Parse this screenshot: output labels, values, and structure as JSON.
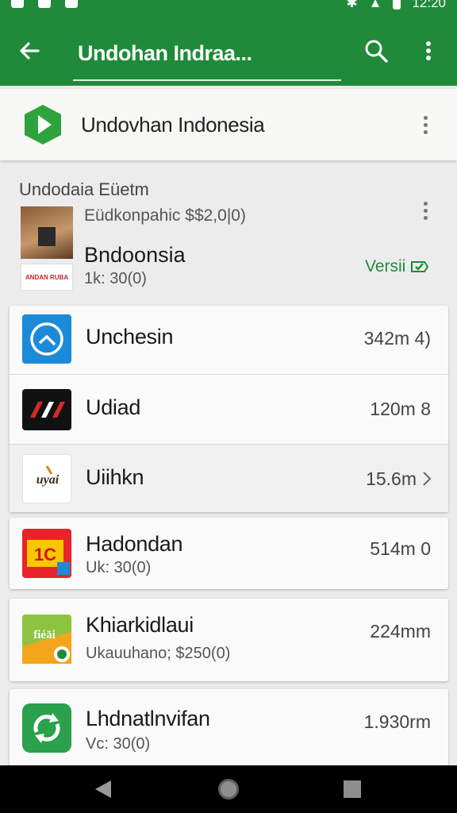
{
  "status_bar": {
    "time": "12:20"
  },
  "app_bar": {
    "search_text": "Undohan Indraa..."
  },
  "header": {
    "title": "Undovhan Indonesia"
  },
  "featured": {
    "section_label": "Undodaia Eüetm",
    "meta": "Eüdkonpahic $$2,0|0)",
    "name": "Bndoonsia",
    "sub": "1k: 30(0)",
    "version_label": "Versii",
    "thumb_text": "ANDAN RUBA"
  },
  "group_one": [
    {
      "name": "Unchesin",
      "size": "342m 4)",
      "icon": "clock-icon"
    },
    {
      "name": "Udiad",
      "size": "120m 8",
      "icon": "udiad-logo-icon"
    },
    {
      "name": "Uiihkn",
      "size": "15.6m",
      "icon": "uyah-logo-icon"
    }
  ],
  "apps": [
    {
      "name": "Hadondan",
      "sub": "Uk: 30(0)",
      "size": "514m 0",
      "icon": "1c-logo-icon"
    },
    {
      "name": "Khiarkidlaui",
      "sub": "Ukauuhano; $250(0)",
      "size": "224mm",
      "icon": "sticker-logo-icon"
    },
    {
      "name": "Lhdnatlnvifan",
      "sub": "Vc: 30(0)",
      "size": "1.930rm",
      "icon": "refresh-logo-icon"
    }
  ],
  "colors": {
    "brand": "#1f8a3a",
    "blue": "#1c8ad9"
  }
}
